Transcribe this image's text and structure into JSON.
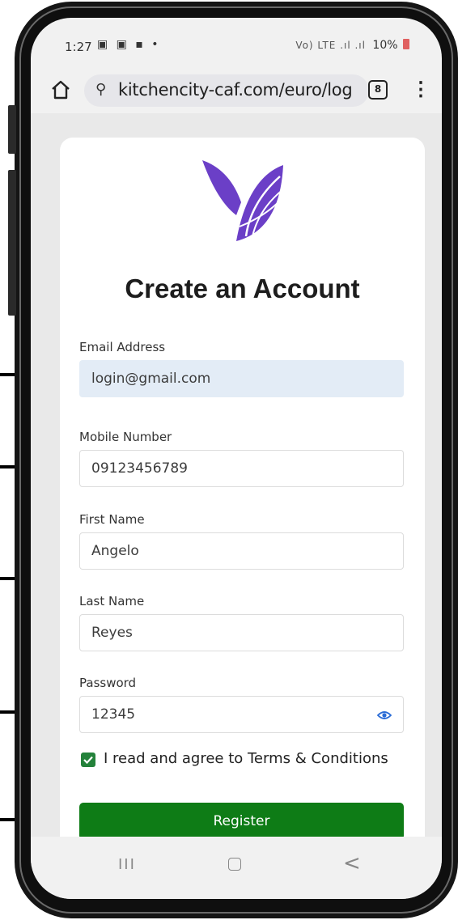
{
  "status_bar": {
    "time": "1:27",
    "left_icons": "▣ ▣ ▪ •",
    "right_icons": "Vo) LTE .ıl .ıl",
    "battery": "10%"
  },
  "browser": {
    "url": "kitchencity-caf.com/euro/log",
    "tab_count": "8",
    "menu_glyph": "⋮",
    "url_icon": "⚲"
  },
  "form": {
    "title": "Create an Account",
    "email_label": "Email Address",
    "email_value": "login@gmail.com",
    "mobile_label": "Mobile Number",
    "mobile_value": "09123456789",
    "first_name_label": "First Name",
    "first_name_value": "Angelo",
    "last_name_label": "Last Name",
    "last_name_value": "Reyes",
    "password_label": "Password",
    "password_value": "12345",
    "terms_label": "I read and agree to Terms & Conditions",
    "terms_checked": true,
    "register_label": "Register"
  },
  "nav": {
    "recents": "III",
    "back": "<"
  },
  "colors": {
    "logo_purple": "#6b3fc7",
    "register_green": "#0e7c16",
    "filled_field": "#e3ecf6",
    "checkbox_green": "#24823b"
  }
}
